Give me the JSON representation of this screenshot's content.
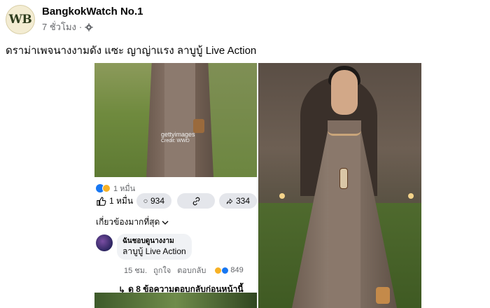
{
  "post": {
    "avatar_initials": "WB",
    "page_name": "BangkokWatch No.1",
    "time": "7 ชั่วโมง",
    "separator": "·",
    "caption": "ดราม่าเพจนางงามดัง แซะ ญาญ่าแรง ลาบูบู้ Live Action"
  },
  "screenshot": {
    "watermark": "gettyimages",
    "watermark_credit": "Credit: WWD",
    "reaction_count": "1 หมื่น",
    "actions": {
      "like_count": "1 หมื่น",
      "comment_count": "934",
      "share_count": "334"
    },
    "related_label": "เกี่ยวข้องมากที่สุด",
    "comment": {
      "author": "ฉันชอบดูนางงาม",
      "text": "ลาบูบู้ Live Action",
      "age": "15 ชม.",
      "like": "ถูกใจ",
      "reply": "ตอบกลับ",
      "reaction_count": "849"
    },
    "see_previous": "ดู 8 ข้อความตอบกลับก่อนหน้านี้"
  },
  "colors": {
    "facebook_blue": "#1877f2",
    "secondary_text": "#65676b"
  }
}
